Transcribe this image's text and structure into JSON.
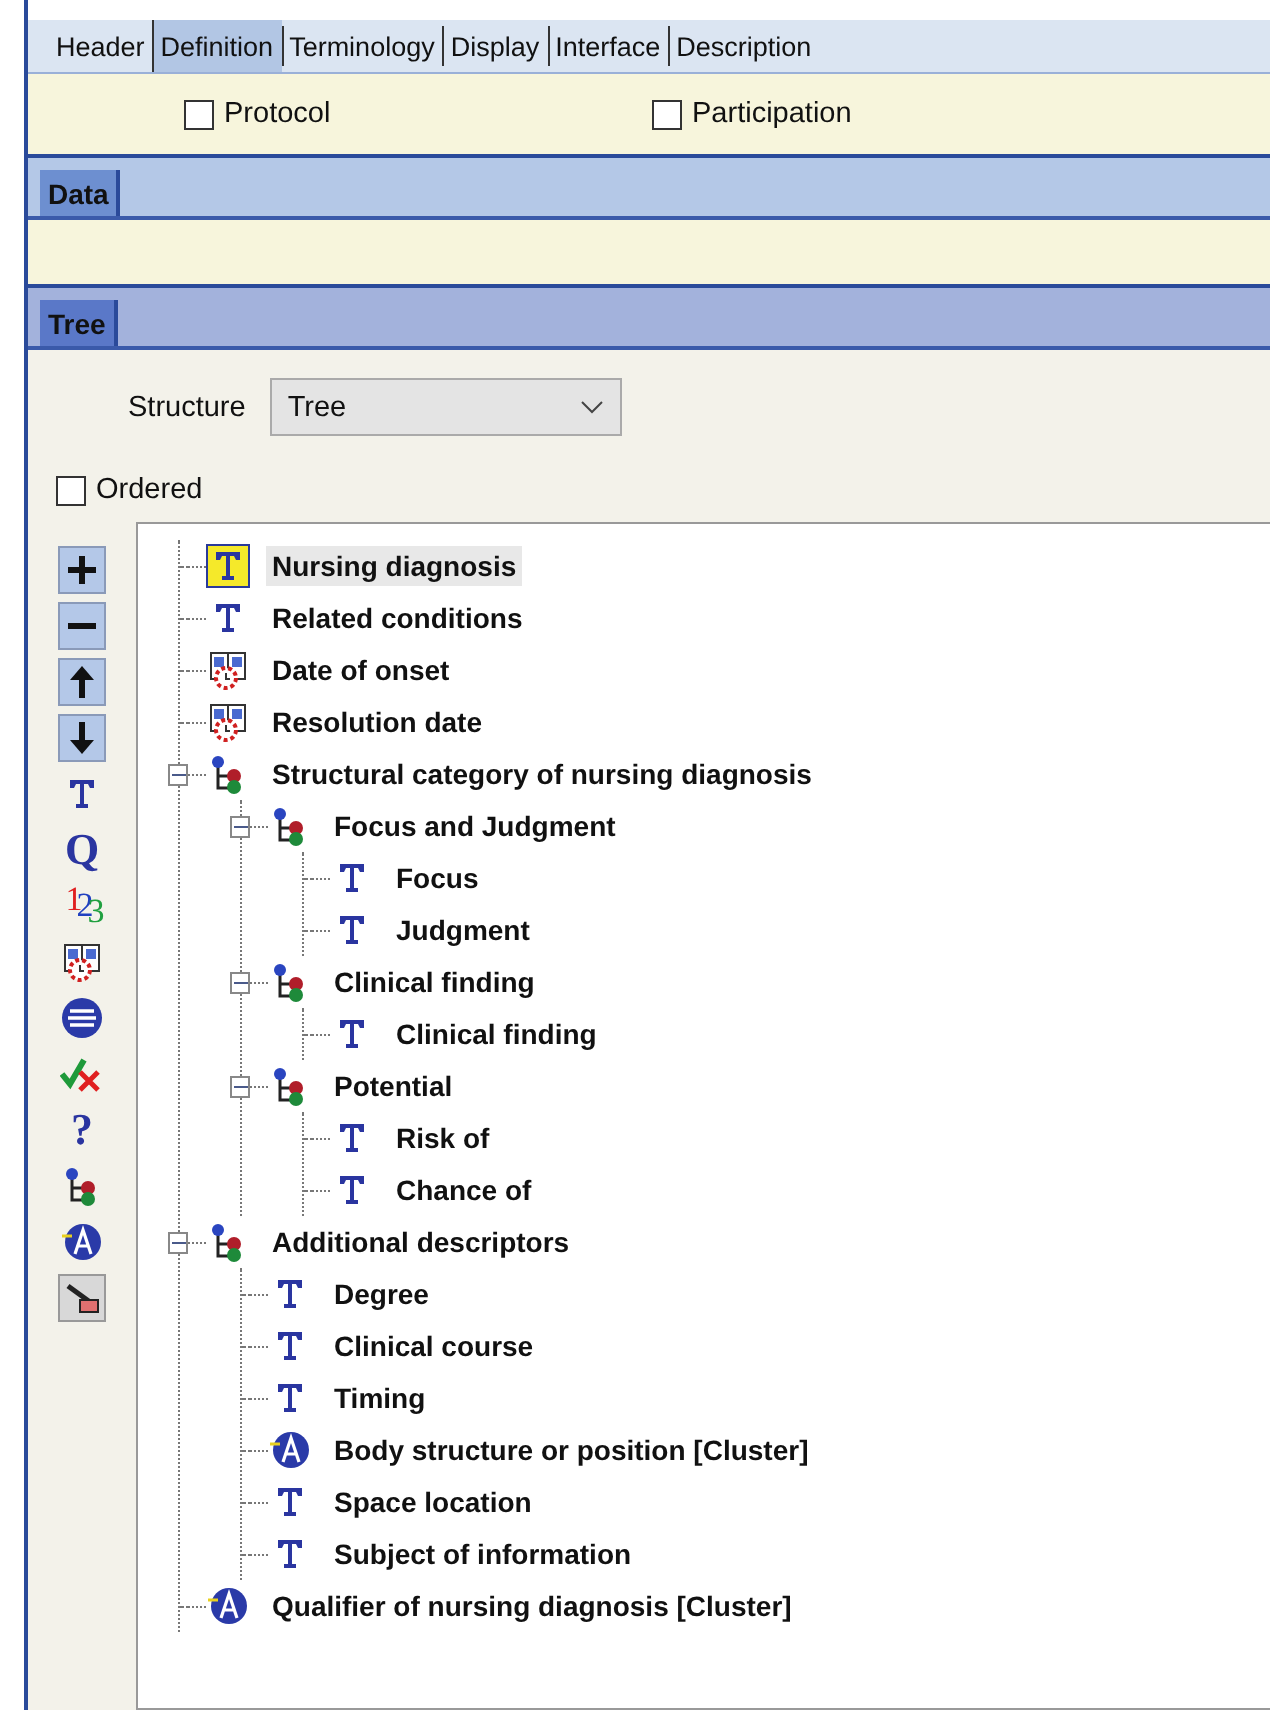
{
  "tabs": [
    {
      "label": "Header",
      "selected": false
    },
    {
      "label": "Definition",
      "selected": true
    },
    {
      "label": "Terminology",
      "selected": false
    },
    {
      "label": "Display",
      "selected": false
    },
    {
      "label": "Interface",
      "selected": false
    },
    {
      "label": "Description",
      "selected": false
    }
  ],
  "options": [
    {
      "label": "Protocol",
      "checked": false
    },
    {
      "label": "Participation",
      "checked": false
    }
  ],
  "data_section": {
    "title": "Data"
  },
  "tree_section": {
    "title": "Tree"
  },
  "structure": {
    "label": "Structure",
    "value": "Tree"
  },
  "ordered": {
    "label": "Ordered",
    "checked": false
  },
  "toolbar": [
    {
      "kind": "add"
    },
    {
      "kind": "remove"
    },
    {
      "kind": "up"
    },
    {
      "kind": "down"
    },
    {
      "kind": "text"
    },
    {
      "kind": "glyph",
      "glyph": "Q"
    },
    {
      "kind": "count",
      "glyph": "123"
    },
    {
      "kind": "datetime"
    },
    {
      "kind": "choice"
    },
    {
      "kind": "boolean"
    },
    {
      "kind": "glyph",
      "glyph": "?"
    },
    {
      "kind": "cluster"
    },
    {
      "kind": "slot"
    },
    {
      "kind": "edit"
    }
  ],
  "tree": [
    {
      "label": "Nursing diagnosis",
      "kind": "text",
      "selected": true
    },
    {
      "label": "Related conditions",
      "kind": "text",
      "selected": false
    },
    {
      "label": "Date of onset",
      "kind": "datetime",
      "selected": false
    },
    {
      "label": "Resolution date",
      "kind": "datetime",
      "selected": false
    },
    {
      "label": "Structural category of nursing diagnosis",
      "kind": "cluster",
      "selected": false,
      "expanded": true,
      "children": [
        {
          "label": "Focus and Judgment",
          "kind": "cluster",
          "selected": false,
          "expanded": true,
          "children": [
            {
              "label": "Focus",
              "kind": "text",
              "selected": false
            },
            {
              "label": "Judgment",
              "kind": "text",
              "selected": false
            }
          ]
        },
        {
          "label": "Clinical finding",
          "kind": "cluster",
          "selected": false,
          "expanded": true,
          "children": [
            {
              "label": "Clinical finding",
              "kind": "text",
              "selected": false
            }
          ]
        },
        {
          "label": "Potential",
          "kind": "cluster",
          "selected": false,
          "expanded": true,
          "children": [
            {
              "label": "Risk of",
              "kind": "text",
              "selected": false
            },
            {
              "label": "Chance of",
              "kind": "text",
              "selected": false
            }
          ]
        }
      ]
    },
    {
      "label": "Additional descriptors",
      "kind": "cluster",
      "selected": false,
      "expanded": true,
      "children": [
        {
          "label": "Degree",
          "kind": "text",
          "selected": false
        },
        {
          "label": "Clinical course",
          "kind": "text",
          "selected": false
        },
        {
          "label": "Timing",
          "kind": "text",
          "selected": false
        },
        {
          "label": "Body structure or position [Cluster]",
          "kind": "slot",
          "selected": false
        },
        {
          "label": "Space location",
          "kind": "text",
          "selected": false
        },
        {
          "label": "Subject of information",
          "kind": "text",
          "selected": false
        }
      ]
    },
    {
      "label": "Qualifier of nursing diagnosis [Cluster]",
      "kind": "slot",
      "selected": false
    }
  ]
}
